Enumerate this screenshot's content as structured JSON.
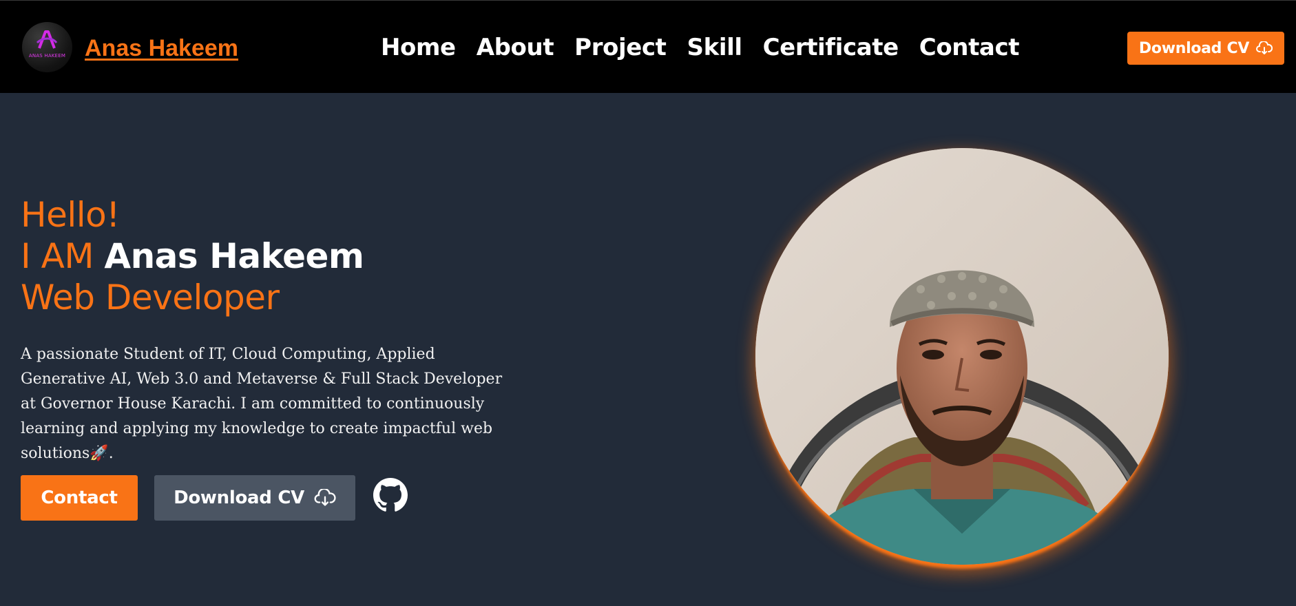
{
  "nav": {
    "logo_text": "ANAS HAKEEM",
    "brand": "Anas Hakeem",
    "links": [
      "Home",
      "About",
      "Project",
      "Skill",
      "Certificate",
      "Contact"
    ],
    "download_cv": "Download CV",
    "download_icon": "cloud-download-icon"
  },
  "hero": {
    "greeting": "Hello!",
    "iam": "I AM",
    "name": "Anas Hakeem",
    "role": "Web Developer",
    "description": "A passionate Student of IT, Cloud Computing, Applied Generative AI, Web 3.0 and Metaverse & Full Stack Developer at Governor House Karachi. I am committed to continuously learning and applying my knowledge to create impactful web solutions🚀.",
    "contact_button": "Contact",
    "download_cv_button": "Download CV",
    "github_icon": "github-icon"
  },
  "colors": {
    "accent": "#f97316",
    "background": "#222b39",
    "navbar": "#000000",
    "secondary_button": "#4b5563"
  }
}
